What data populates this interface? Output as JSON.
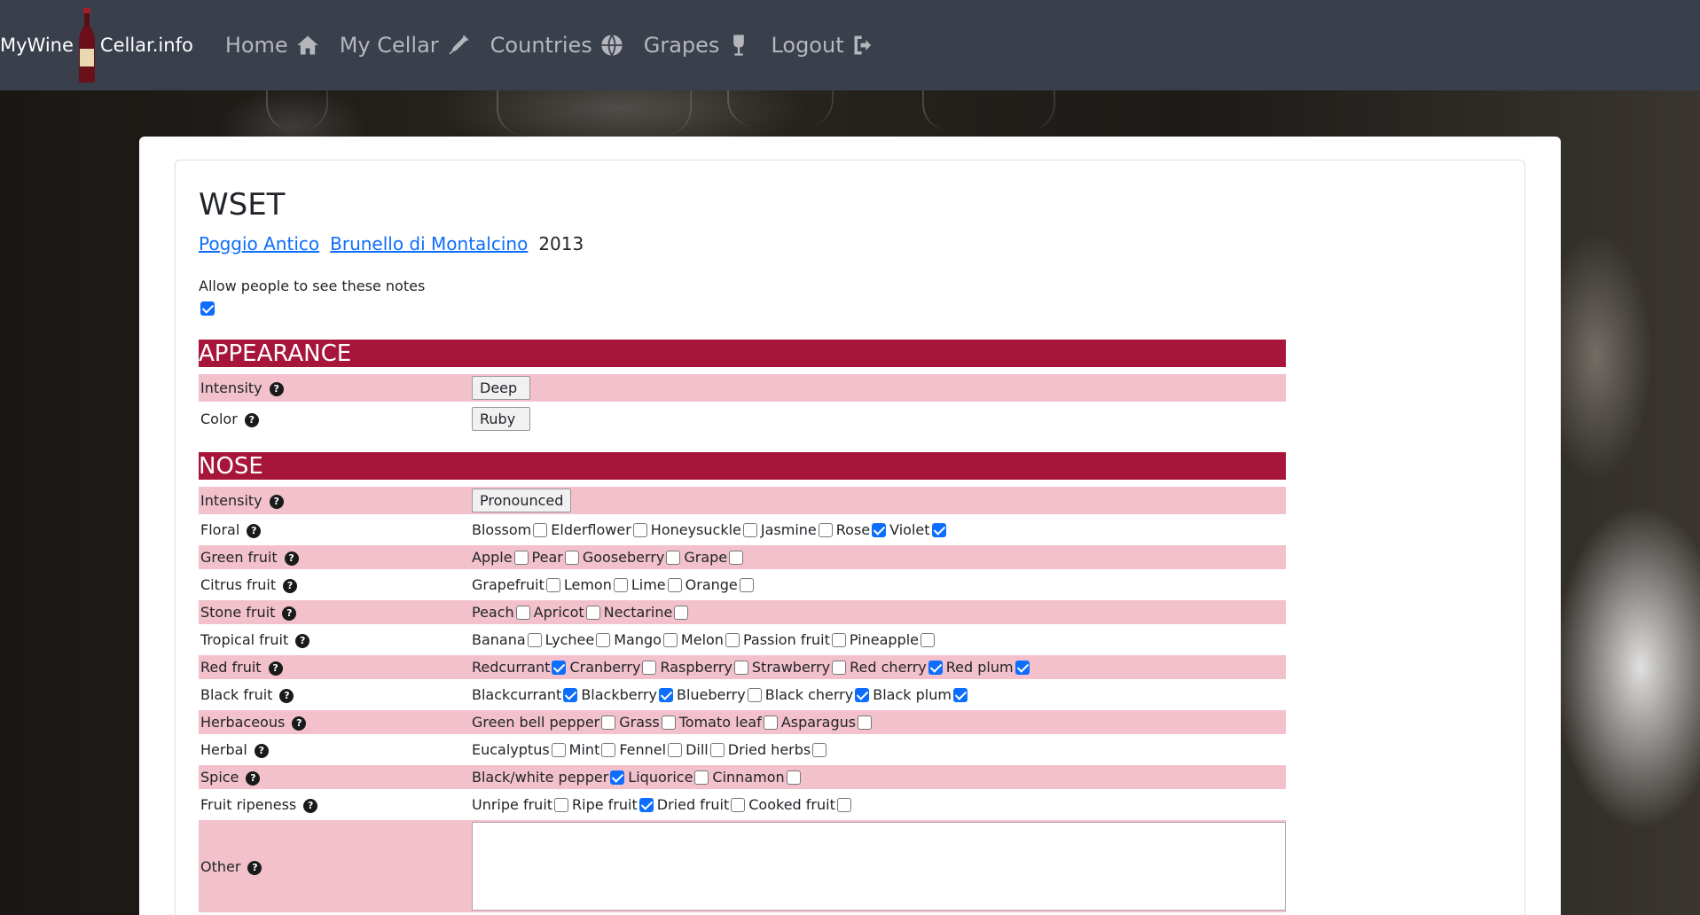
{
  "brand": {
    "left": "MyWine",
    "right": "Cellar.info"
  },
  "nav": [
    {
      "label": "Home",
      "icon": "home-icon"
    },
    {
      "label": "My Cellar",
      "icon": "bottle-icon"
    },
    {
      "label": "Countries",
      "icon": "globe-icon"
    },
    {
      "label": "Grapes",
      "icon": "wine-glass-icon"
    },
    {
      "label": "Logout",
      "icon": "logout-icon"
    }
  ],
  "page": {
    "title": "WSET",
    "producer": "Poggio Antico",
    "wine": "Brunello di Montalcino",
    "vintage": "2013",
    "share_label": "Allow people to see these notes",
    "share_checked": true
  },
  "appearance": {
    "heading": "APPEARANCE",
    "rows": [
      {
        "label": "Intensity",
        "value": "Deep"
      },
      {
        "label": "Color",
        "value": "Ruby"
      }
    ]
  },
  "nose": {
    "heading": "NOSE",
    "intensity": {
      "label": "Intensity",
      "value": "Pronounced"
    },
    "rows": [
      {
        "label": "Floral",
        "options": [
          {
            "name": "Blossom",
            "checked": false
          },
          {
            "name": "Elderflower",
            "checked": false
          },
          {
            "name": "Honeysuckle",
            "checked": false
          },
          {
            "name": "Jasmine",
            "checked": false
          },
          {
            "name": "Rose",
            "checked": true
          },
          {
            "name": "Violet",
            "checked": true
          }
        ]
      },
      {
        "label": "Green fruit",
        "options": [
          {
            "name": "Apple",
            "checked": false
          },
          {
            "name": "Pear",
            "checked": false
          },
          {
            "name": "Gooseberry",
            "checked": false
          },
          {
            "name": "Grape",
            "checked": false
          }
        ]
      },
      {
        "label": "Citrus fruit",
        "options": [
          {
            "name": "Grapefruit",
            "checked": false
          },
          {
            "name": "Lemon",
            "checked": false
          },
          {
            "name": "Lime",
            "checked": false
          },
          {
            "name": "Orange",
            "checked": false
          }
        ]
      },
      {
        "label": "Stone fruit",
        "options": [
          {
            "name": "Peach",
            "checked": false
          },
          {
            "name": "Apricot",
            "checked": false
          },
          {
            "name": "Nectarine",
            "checked": false
          }
        ]
      },
      {
        "label": "Tropical fruit",
        "options": [
          {
            "name": "Banana",
            "checked": false
          },
          {
            "name": "Lychee",
            "checked": false
          },
          {
            "name": "Mango",
            "checked": false
          },
          {
            "name": "Melon",
            "checked": false
          },
          {
            "name": "Passion fruit",
            "checked": false
          },
          {
            "name": "Pineapple",
            "checked": false
          }
        ]
      },
      {
        "label": "Red fruit",
        "options": [
          {
            "name": "Redcurrant",
            "checked": true
          },
          {
            "name": "Cranberry",
            "checked": false
          },
          {
            "name": "Raspberry",
            "checked": false
          },
          {
            "name": "Strawberry",
            "checked": false
          },
          {
            "name": "Red cherry",
            "checked": true
          },
          {
            "name": "Red plum",
            "checked": true
          }
        ]
      },
      {
        "label": "Black fruit",
        "options": [
          {
            "name": "Blackcurrant",
            "checked": true
          },
          {
            "name": "Blackberry",
            "checked": true
          },
          {
            "name": "Blueberry",
            "checked": false
          },
          {
            "name": "Black cherry",
            "checked": true
          },
          {
            "name": "Black plum",
            "checked": true
          }
        ]
      },
      {
        "label": "Herbaceous",
        "options": [
          {
            "name": "Green bell pepper",
            "checked": false
          },
          {
            "name": "Grass",
            "checked": false
          },
          {
            "name": "Tomato leaf",
            "checked": false
          },
          {
            "name": "Asparagus",
            "checked": false
          }
        ]
      },
      {
        "label": "Herbal",
        "options": [
          {
            "name": "Eucalyptus",
            "checked": false
          },
          {
            "name": "Mint",
            "checked": false
          },
          {
            "name": "Fennel",
            "checked": false
          },
          {
            "name": "Dill",
            "checked": false
          },
          {
            "name": "Dried herbs",
            "checked": false
          }
        ]
      },
      {
        "label": "Spice",
        "options": [
          {
            "name": "Black/white pepper",
            "checked": true
          },
          {
            "name": "Liquorice",
            "checked": false
          },
          {
            "name": "Cinnamon",
            "checked": false
          }
        ]
      },
      {
        "label": "Fruit ripeness",
        "options": [
          {
            "name": "Unripe fruit",
            "checked": false
          },
          {
            "name": "Ripe fruit",
            "checked": true
          },
          {
            "name": "Dried fruit",
            "checked": false
          },
          {
            "name": "Cooked fruit",
            "checked": false
          }
        ]
      }
    ],
    "other": {
      "label": "Other",
      "value": ""
    }
  },
  "colors": {
    "navbar": "#3a3f4c",
    "section": "#a8153b",
    "row_alt": "#f2c1cb",
    "link": "#0d6efd"
  }
}
